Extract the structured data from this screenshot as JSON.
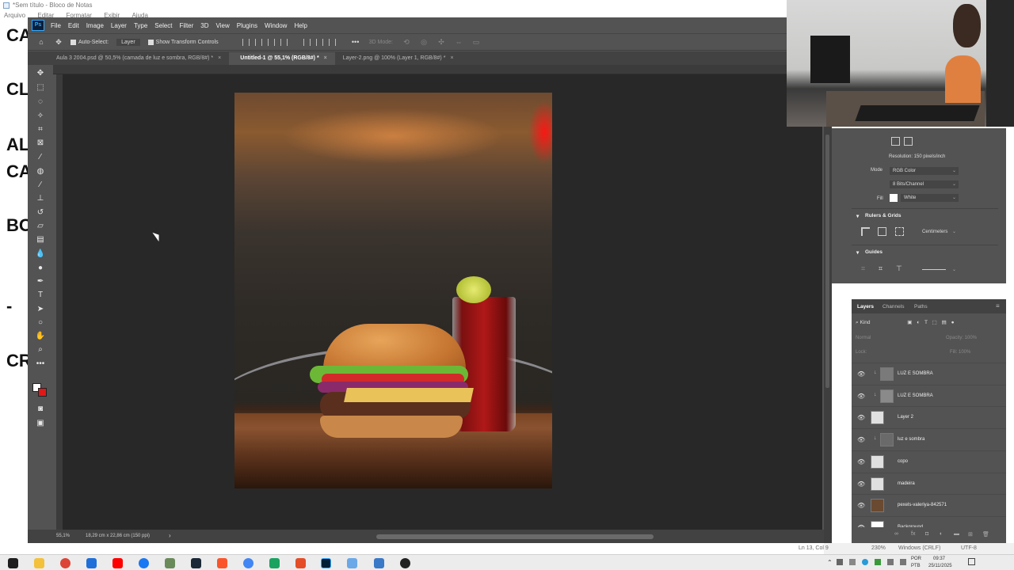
{
  "notepad": {
    "title": "*Sem título - Bloco de Notas",
    "menu": [
      "Arquivo",
      "Editar",
      "Formatar",
      "Exibir",
      "Ajuda"
    ],
    "lines": [
      "CA",
      "CL",
      "AL",
      "CA",
      "BO",
      "-",
      "CR"
    ],
    "status": {
      "position": "Ln 13, Col 9",
      "zoom": "230%",
      "eol": "Windows (CRLF)",
      "encoding": "UTF-8"
    }
  },
  "photoshop": {
    "logo": "Ps",
    "menu": [
      "File",
      "Edit",
      "Image",
      "Layer",
      "Type",
      "Select",
      "Filter",
      "3D",
      "View",
      "Plugins",
      "Window",
      "Help"
    ],
    "options": {
      "auto_select": "Auto-Select:",
      "target": "Layer",
      "show_transform": "Show Transform Controls",
      "mode_3d": "3D Mode:"
    },
    "tabs": [
      {
        "label": "Aula 3 2004.psd @ 50,5% (camada de luz e sombra, RGB/8#) *",
        "active": false
      },
      {
        "label": "Untitled-1 @ 55,1% (RGB/8#) *",
        "active": true
      },
      {
        "label": "Layer-2.png @ 100% (Layer 1, RGB/8#) *",
        "active": false
      }
    ],
    "close_glyph": "×",
    "status": {
      "zoom": "55,1%",
      "dimensions": "18,29 cm x 22,86 cm (150 ppi)",
      "arrow": "›"
    }
  },
  "properties": {
    "resolution": "Resolution: 150 pixels/inch",
    "mode_label": "Mode",
    "mode_value": "RGB Color",
    "depth_value": "8 Bits/Channel",
    "fill_label": "Fill",
    "fill_value": "White",
    "rulers_grids": "Rulers & Grids",
    "units": "Centimeters",
    "guides": "Guides"
  },
  "layers_panel": {
    "tabs": [
      "Layers",
      "Channels",
      "Paths"
    ],
    "filter": "Kind",
    "blend": "Normal",
    "opacity": "Opacity: 100%",
    "lock": "Lock:",
    "fill": "Fill: 100%",
    "layers": [
      {
        "name": "LUZ E SOMBRA",
        "clipped": true,
        "thumb": "#7a7a7a"
      },
      {
        "name": "LUZ E SOMBRA",
        "clipped": true,
        "thumb": "#8a8a8a"
      },
      {
        "name": "Layer 2",
        "clipped": false,
        "thumb": "#e0e0e0"
      },
      {
        "name": "luz e sombra",
        "clipped": true,
        "thumb": "#6a6a6a"
      },
      {
        "name": "copo",
        "clipped": false,
        "thumb": "#e0e0e0"
      },
      {
        "name": "madeira",
        "clipped": false,
        "thumb": "#e0e0e0"
      },
      {
        "name": "pexels-valeriya-842571",
        "clipped": false,
        "thumb": "#6a4a30"
      },
      {
        "name": "Background",
        "clipped": false,
        "thumb": "#ffffff"
      }
    ]
  },
  "taskbar": {
    "tray": {
      "lang": "POR",
      "layout": "PTB",
      "time": "09:37",
      "date": "25/11/2025"
    }
  }
}
